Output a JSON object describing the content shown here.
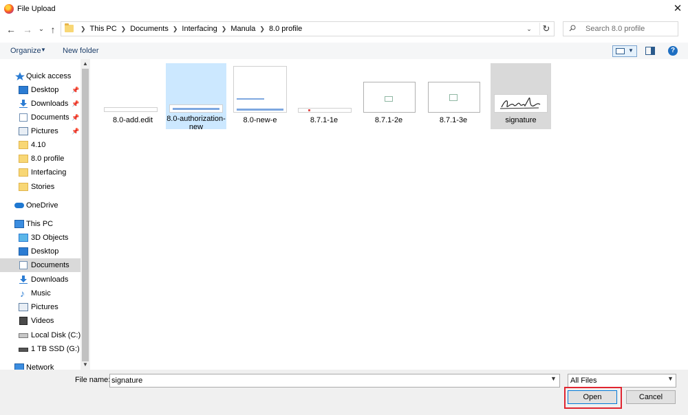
{
  "window": {
    "title": "File Upload",
    "close_glyph": "✕"
  },
  "nav_buttons": {
    "back": "←",
    "forward": "→",
    "recent": "⌄",
    "up": "↑"
  },
  "address": {
    "breadcrumbs": [
      "This PC",
      "Documents",
      "Interfacing",
      "Manula",
      "8.0 profile"
    ],
    "dropdown_glyph": "⌄",
    "refresh_glyph": "↻"
  },
  "search": {
    "placeholder": "Search 8.0 profile"
  },
  "toolbar": {
    "organize_label": "Organize",
    "new_folder_label": "New folder",
    "help_glyph": "?"
  },
  "sidebar": {
    "quick_access": {
      "label": "Quick access"
    },
    "quick_items": [
      {
        "label": "Desktop",
        "icon": "desktop-icon",
        "pinned": true
      },
      {
        "label": "Downloads",
        "icon": "downloads-icon",
        "pinned": true
      },
      {
        "label": "Documents",
        "icon": "documents-icon",
        "pinned": true
      },
      {
        "label": "Pictures",
        "icon": "pictures-icon",
        "pinned": true
      },
      {
        "label": "4.10",
        "icon": "folder-icon",
        "pinned": false
      },
      {
        "label": "8.0 profile",
        "icon": "folder-icon",
        "pinned": false
      },
      {
        "label": "Interfacing",
        "icon": "folder-icon",
        "pinned": false
      },
      {
        "label": "Stories",
        "icon": "folder-icon",
        "pinned": false
      }
    ],
    "onedrive": {
      "label": "OneDrive"
    },
    "this_pc": {
      "label": "This PC"
    },
    "pc_items": [
      {
        "label": "3D Objects",
        "icon": "3d-objects-icon"
      },
      {
        "label": "Desktop",
        "icon": "desktop-icon"
      },
      {
        "label": "Documents",
        "icon": "documents-icon",
        "selected": true
      },
      {
        "label": "Downloads",
        "icon": "downloads-icon"
      },
      {
        "label": "Music",
        "icon": "music-icon"
      },
      {
        "label": "Pictures",
        "icon": "pictures-icon"
      },
      {
        "label": "Videos",
        "icon": "videos-icon"
      },
      {
        "label": "Local Disk (C:)",
        "icon": "local-disk-icon"
      },
      {
        "label": "1 TB SSD (G:)",
        "icon": "drive-icon"
      }
    ],
    "network": {
      "label": "Network"
    }
  },
  "files": [
    {
      "name": "8.0-add.edit",
      "state": "normal"
    },
    {
      "name": "8.0-authorization-new",
      "state": "selected"
    },
    {
      "name": "8.0-new-e",
      "state": "normal"
    },
    {
      "name": "8.7.1-1e",
      "state": "normal"
    },
    {
      "name": "8.7.1-2e",
      "state": "normal"
    },
    {
      "name": "8.7.1-3e",
      "state": "normal"
    },
    {
      "name": "signature",
      "state": "hover"
    }
  ],
  "footer": {
    "file_name_label": "File name:",
    "file_name_value": "signature",
    "file_type": "All Files",
    "open_label": "Open",
    "cancel_label": "Cancel"
  },
  "colors": {
    "selected_tile": "#cce8ff",
    "accent": "#0078d7",
    "highlight_box": "#e0242f"
  }
}
